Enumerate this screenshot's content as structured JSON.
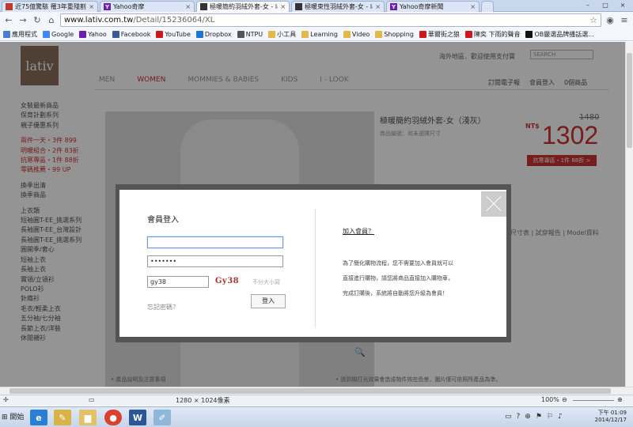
{
  "browser": {
    "tabs": [
      {
        "title": "近75億驚駭 罹3年重殘割...",
        "favicon_color": "#c0392b",
        "active": false
      },
      {
        "title": "Yahoo奇摩",
        "favicon_color": "#6b1fb1",
        "active": false
      },
      {
        "title": "極暖簡約羽絨外套-女 - lat",
        "favicon_color": "#333333",
        "active": true
      },
      {
        "title": "極暖束性羽絨外套-女 - la",
        "favicon_color": "#333333",
        "active": false
      },
      {
        "title": "Yahoo奇摩新聞",
        "favicon_color": "#6b1fb1",
        "active": false
      }
    ],
    "url_host": "www.lativ.com.tw",
    "url_path": "/Detail/15236064/XL",
    "bookmarks": [
      {
        "label": "應用程式",
        "icon": "apps-icon",
        "color": "#4a7fd0"
      },
      {
        "label": "Google",
        "icon": "google-icon",
        "color": "#4285f4"
      },
      {
        "label": "Yahoo",
        "icon": "yahoo-icon",
        "color": "#6b1fb1"
      },
      {
        "label": "Facebook",
        "icon": "facebook-icon",
        "color": "#3b5998"
      },
      {
        "label": "YouTube",
        "icon": "youtube-icon",
        "color": "#cc181e"
      },
      {
        "label": "Dropbox",
        "icon": "dropbox-icon",
        "color": "#1f75d0"
      },
      {
        "label": "NTPU",
        "icon": "ntpu-icon",
        "color": "#555555"
      },
      {
        "label": "小工具",
        "icon": "folder-icon",
        "color": "#e1b94a"
      },
      {
        "label": "Learning",
        "icon": "folder-icon",
        "color": "#e1b94a"
      },
      {
        "label": "Video",
        "icon": "folder-icon",
        "color": "#e1b94a"
      },
      {
        "label": "Shopping",
        "icon": "folder-icon",
        "color": "#e1b94a"
      },
      {
        "label": "華爾街之狼",
        "icon": "youtube-icon",
        "color": "#cc181e"
      },
      {
        "label": "陳奕 下雨的聲音",
        "icon": "youtube-icon",
        "color": "#cc181e"
      },
      {
        "label": "OB嚴選品牌播話選...",
        "icon": "ob-icon",
        "color": "#111111"
      }
    ]
  },
  "site": {
    "logo": "lativ",
    "util_text": "海外地區．歡迎使用支付寶",
    "search_placeholder": "SEARCH",
    "nav": [
      "MEN",
      "WOMEN",
      "MOMMIES & BABIES",
      "KIDS",
      "I - LOOK"
    ],
    "right_nav": [
      "訂閱電子報",
      "會員登入",
      "0個商品"
    ],
    "sidebar_groups": [
      [
        "女裝最新商品",
        "保育計劃系列",
        "親子優惠系列"
      ],
      [
        "兩件一天・3件 899",
        "明暖組合・2件 83折",
        "抗寒專區・1件 88折",
        "零碼推薦・99 UP"
      ],
      [
        "換季出清",
        "換季商品"
      ],
      [
        "上衣類",
        "短袖圓T-EE_挑選系列",
        "長袖圓T-EE_台灣設計",
        "長袖圓T-EE_挑選系列",
        "圓開季/套心",
        "短袖上衣",
        "長袖上衣",
        "實領/立領衫",
        "POLO衫",
        "針織衫",
        "毛衣/輕柔上衣",
        "五分袖/七分袖",
        "長節上衣/洋裝",
        "休閒襯衫"
      ]
    ],
    "product_title": "極暖簡約羽絨外套-女（淺灰）",
    "product_sub": "商品編號：尚未選擇尺寸",
    "old_price": "1480",
    "currency": "NT$",
    "price": "1302",
    "promo": "抗寒專區・1件 88折 >",
    "specs": "尺寸表 | 試穿報告 | Model資料",
    "footer_left": "• 產品說明及注意事項",
    "footer_right": "• 過到期打光效果會造成物件效在色差，圖片僅可依照所產品為準。"
  },
  "modal": {
    "title": "會員登入",
    "email_value": "",
    "password_mask": "•••••••",
    "captcha_input": "gy38",
    "captcha_image_text": "Gy38",
    "captcha_hint": "不分大小寫",
    "forgot_label": "忘記密碼？",
    "login_label": "登入",
    "join_title": "加入會員？",
    "join_lines": [
      "為了簡化購物流程，您不需要加入會員就可以",
      "直接進行購物，請您將商品直接加入購物車，",
      "完成訂購後，系統將自動將您升級為會員！"
    ]
  },
  "statusbar": {
    "resolution": "1280 × 1024像素",
    "zoom": "100%"
  },
  "taskbar": {
    "start_label": "開始",
    "time": "下午 01:09",
    "date": "2014/12/17"
  }
}
